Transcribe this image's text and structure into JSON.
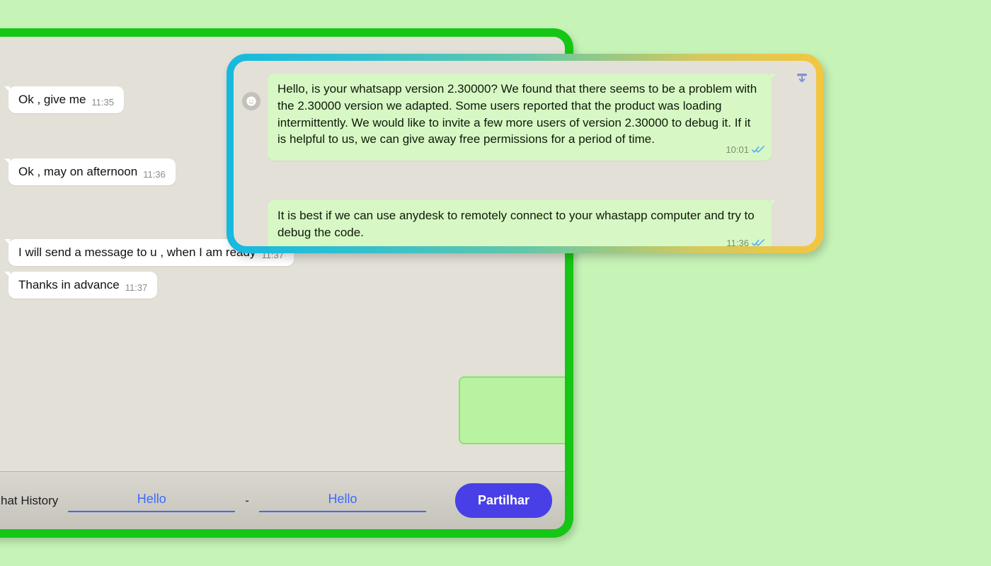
{
  "chat": {
    "received": [
      {
        "text": "Ok , give me",
        "time": "11:35"
      },
      {
        "text": "Ok , may on afternoon",
        "time": "11:36"
      },
      {
        "text": "I will send  a message to u , when I am ready",
        "time": "11:37"
      },
      {
        "text": "Thanks in advance",
        "time": "11:37"
      }
    ]
  },
  "share_bar": {
    "label": "hare Chat History",
    "from_value": "Hello",
    "to_value": "Hello",
    "button": "Partilhar"
  },
  "overlay": {
    "messages": [
      {
        "text": "Hello, is your whatsapp version 2.30000? We found that there seems to be a problem with the 2.30000 version we adapted. Some users reported that the product was loading intermittently. We would like to invite a few more users of version 2.30000 to debug it. If it is helpful to us, we can give away free permissions for a period of time.",
        "time": "10:01"
      },
      {
        "text": "It is best if we can use anydesk to remotely connect to your whastapp computer and try to debug the code.",
        "time": "11:36"
      }
    ]
  }
}
